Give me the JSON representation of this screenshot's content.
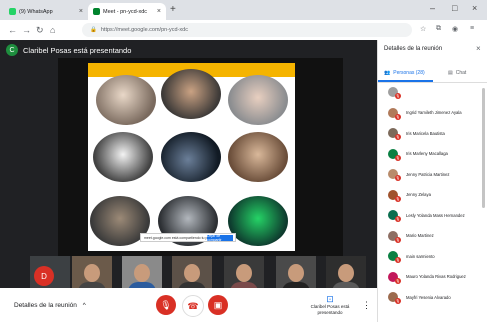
{
  "browser": {
    "tabs": [
      {
        "label": "(9) WhatsApp",
        "active": false,
        "icon": "whatsapp-icon",
        "icon_color": "#25d366"
      },
      {
        "label": "Meet - pn-ycd-xdc",
        "active": true,
        "icon": "meet-icon",
        "icon_color": "#00832d"
      }
    ],
    "url": "https://meet.google.com/pn-ycd-xdc",
    "new_tab": "+"
  },
  "meet": {
    "presenter_initial": "C",
    "presenter_text": "Claribel Posas está presentando",
    "tile_initial": "D",
    "share_popup_text": "meet.google.com está compartiendo tu pantalla.",
    "share_popup_button": "Dejar de compartir",
    "meeting_details": "Detalles de la reunión",
    "presenting_label": "Claribel Posas está presentando"
  },
  "panel": {
    "title": "Detalles de la reunión",
    "tab_people": "Personas (28)",
    "tab_chat": "Chat",
    "participants": [
      {
        "name": "",
        "color": "#9e9e9e"
      },
      {
        "name": "Ingrid Yamileth Jimenez Ayala",
        "color": "#b07a5a"
      },
      {
        "name": "Iris Maricela Bautista",
        "color": "#7c6a5b"
      },
      {
        "name": "Iris Marleny Macallaga",
        "color": "#0b8043"
      },
      {
        "name": "Jenny Patricia Martinez",
        "color": "#b88b6b"
      },
      {
        "name": "Jenny Zelaya",
        "color": "#a0522d"
      },
      {
        "name": "Lesly Yolanda Mass Hernandez",
        "color": "#0b6e4f"
      },
      {
        "name": "Mario Martinez",
        "color": "#8d6e63"
      },
      {
        "name": "main sarmiento",
        "color": "#0b8043"
      },
      {
        "name": "Mauro Yolanda Rivas Rodriguez",
        "color": "#c2185b"
      },
      {
        "name": "Mayfri Yesenia Alvarado",
        "color": "#9c6b4e"
      }
    ],
    "colors": {
      "accent": "#1a73e8",
      "badge": "#d93025"
    }
  }
}
